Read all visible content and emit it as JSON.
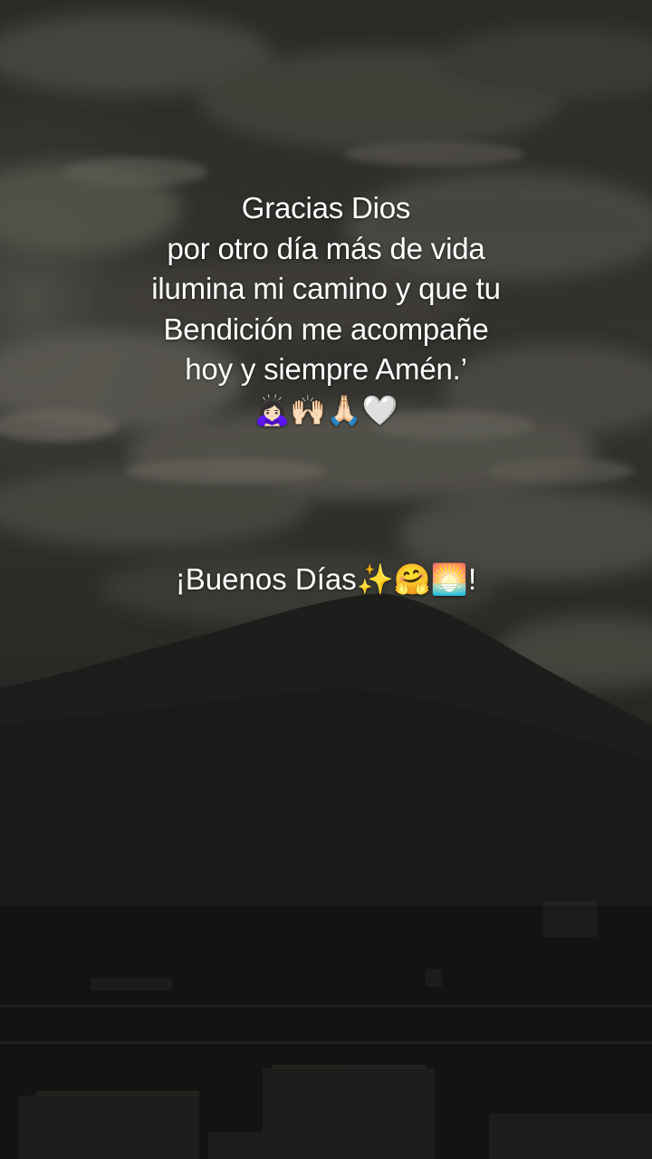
{
  "caption": {
    "prayer_lines": [
      "Gracias Dios",
      "por otro día más de vida",
      "ilumina mi camino y que tu",
      "Bendición me acompañe",
      "hoy y siempre Amén.’"
    ],
    "prayer_emojis": "🙇🏻‍♀️🙌🏻🙏🏻🤍",
    "greeting_text": "¡Buenos Días",
    "greeting_emojis": "✨🤗🌅",
    "greeting_end": "!"
  },
  "scene": {
    "description_colors": {
      "sky_dark": "#2a2a27",
      "cloud_light": "#6d6b62",
      "mountain": "#1b1b19",
      "city": "#161615"
    }
  }
}
